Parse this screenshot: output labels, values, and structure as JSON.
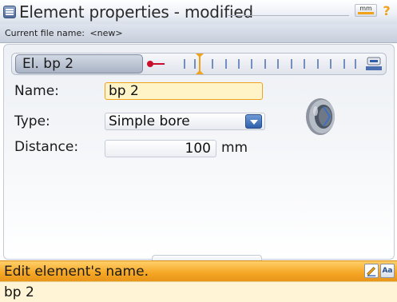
{
  "titlebar": {
    "title": "Element properties - modified",
    "unit_badge": "mm",
    "app_icon": "app-menu-icon",
    "help_icon": "help-icon"
  },
  "file": {
    "label": "Current file name:",
    "value": "<new>"
  },
  "element_selector": {
    "label": "El. bp 2"
  },
  "form": {
    "name_label": "Name:",
    "name_value": "bp 2",
    "type_label": "Type:",
    "type_value": "Simple bore",
    "distance_label": "Distance:",
    "distance_value": "100",
    "distance_unit": "mm"
  },
  "status": {
    "message": "Edit element's name."
  },
  "input_line": {
    "value": "bp 2"
  },
  "colors": {
    "accent": "#f5a623",
    "selection_fill": "#fff3c8",
    "marker_red": "#c8102e",
    "title_gradient_end": "#d9dfe9"
  }
}
